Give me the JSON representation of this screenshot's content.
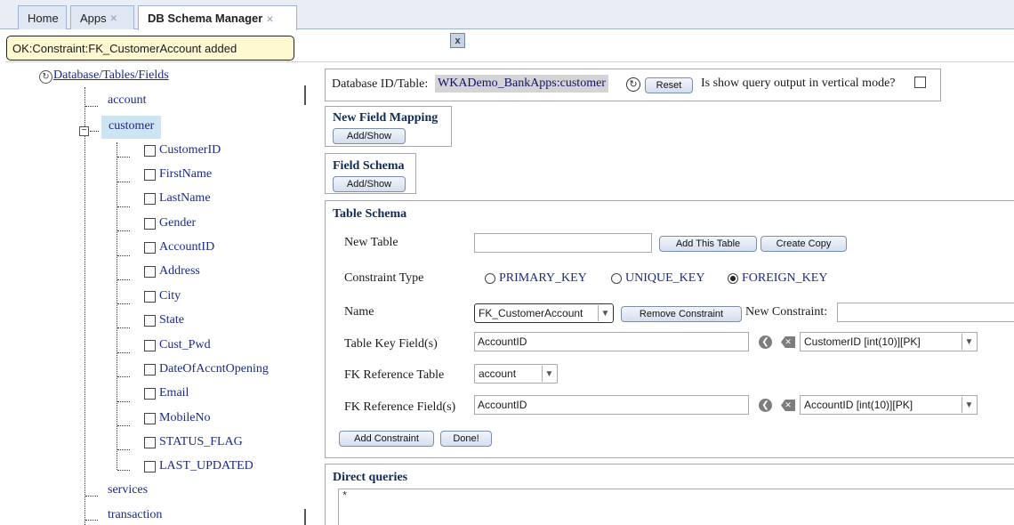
{
  "tabs": [
    {
      "label": "Home",
      "closable": false
    },
    {
      "label": "Apps",
      "closable": true
    },
    {
      "label": "DB Schema Manager",
      "closable": true,
      "active": true
    }
  ],
  "close_glyph": "×",
  "status": {
    "message": "OK:Constraint:FK_CustomerAccount added",
    "close_label": "x"
  },
  "tree": {
    "root_label": "Database/Tables/Fields",
    "tables": [
      "account",
      "customer",
      "services",
      "transaction"
    ],
    "selected_table": "customer",
    "fields": [
      "CustomerID",
      "FirstName",
      "LastName",
      "Gender",
      "AccountID",
      "Address",
      "City",
      "State",
      "Cust_Pwd",
      "DateOfAccntOpening",
      "Email",
      "MobileNo",
      "STATUS_FLAG",
      "LAST_UPDATED"
    ]
  },
  "db_panel": {
    "label": "Database ID/Table:",
    "value": "WKADemo_BankApps:customer",
    "reset_label": "Reset",
    "vertical_label": "Is show query output in vertical mode?"
  },
  "new_field_mapping": {
    "title": "New Field Mapping",
    "button": "Add/Show"
  },
  "field_schema": {
    "title": "Field Schema",
    "button": "Add/Show"
  },
  "table_schema": {
    "title": "Table Schema",
    "new_table_label": "New Table",
    "new_table_value": "",
    "add_table_button": "Add This Table",
    "create_copy_button": "Create Copy",
    "constraint_type_label": "Constraint Type",
    "constraint_types": [
      "PRIMARY_KEY",
      "UNIQUE_KEY",
      "FOREIGN_KEY"
    ],
    "constraint_type_selected": "FOREIGN_KEY",
    "name_label": "Name",
    "name_value": "FK_CustomerAccount",
    "remove_button": "Remove Constraint",
    "new_constraint_label": "New Constraint:",
    "new_constraint_value": "",
    "table_key_label": "Table Key Field(s)",
    "table_key_value": "AccountID",
    "table_key_select": "CustomerID [int(10)][PK]",
    "fk_ref_table_label": "FK Reference Table",
    "fk_ref_table_value": "account",
    "fk_ref_field_label": "FK Reference Field(s)",
    "fk_ref_field_value": "AccountID",
    "fk_ref_field_select": "AccountID [int(10)][PK]",
    "add_constraint_button": "Add Constraint",
    "done_button": "Done!"
  },
  "direct_queries": {
    "title": "Direct queries",
    "content": "*"
  }
}
